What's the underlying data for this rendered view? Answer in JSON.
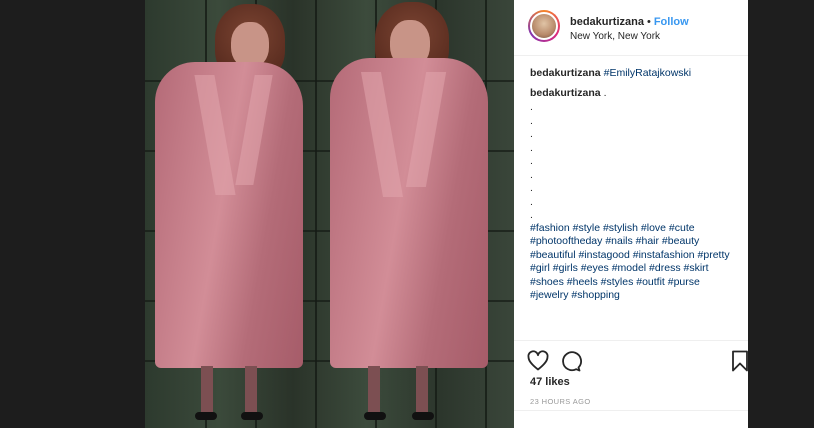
{
  "post": {
    "username": "bedakurtizana",
    "separator": "•",
    "follow_label": "Follow",
    "location": "New York, New York"
  },
  "comments": [
    {
      "user": "bedakurtizana",
      "text": "#EmilyRatajkowski"
    },
    {
      "user": "bedakurtizana",
      "text": "."
    }
  ],
  "caption_dots": [
    ".",
    ".",
    ".",
    ".",
    ".",
    ".",
    ".",
    ".",
    "."
  ],
  "hashtags": "#fashion #style #stylish #love #cute #photooftheday #nails #hair #beauty #beautiful #instagood #instafashion #pretty #girl #girls #eyes #model #dress #skirt #shoes #heels #styles #outfit #purse #jewelry #shopping",
  "actions": {
    "like_icon": "heart-icon",
    "comment_icon": "comment-icon",
    "save_icon": "bookmark-icon"
  },
  "likes": "47 likes",
  "timestamp": "23 HOURS AGO",
  "colors": {
    "follow": "#3897f0",
    "hashtag": "#003569",
    "text": "#262626",
    "muted": "#999999",
    "coat": "#c98089"
  }
}
